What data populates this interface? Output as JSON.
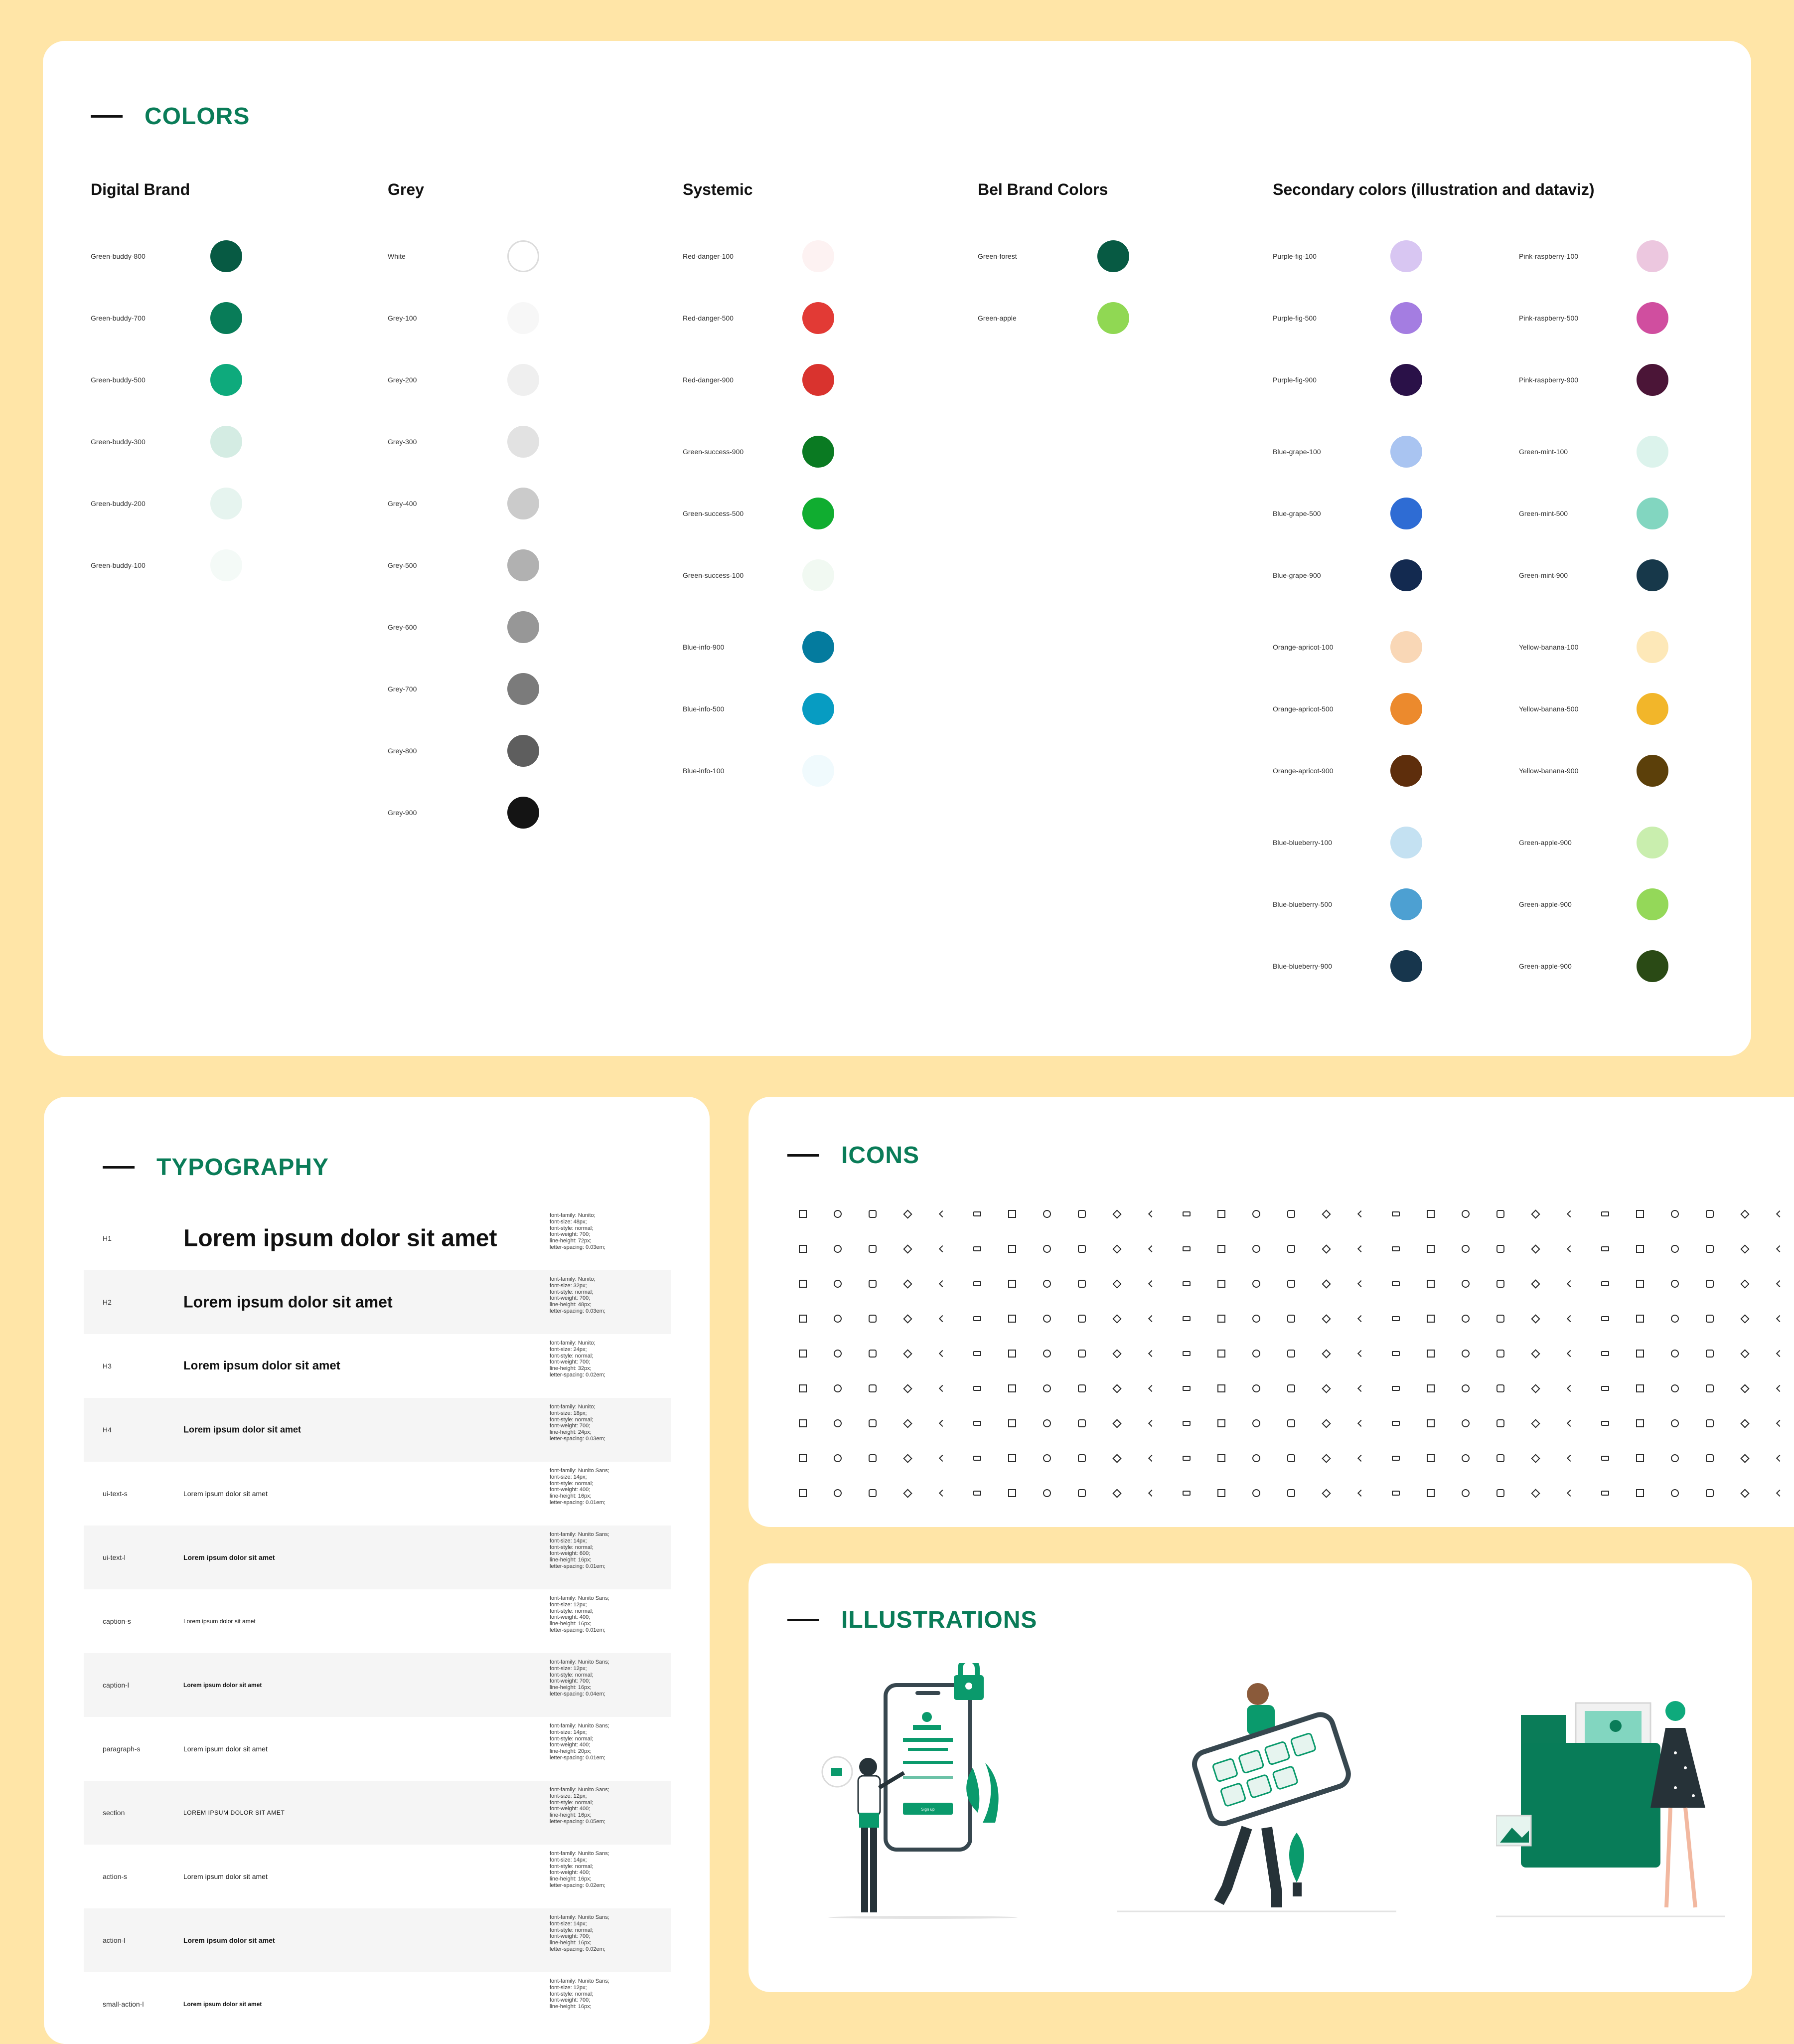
{
  "colors": {
    "title": "COLORS",
    "groups": [
      {
        "title": "Digital Brand",
        "swatches": [
          {
            "label": "Green-buddy-800",
            "color": "#075a43"
          },
          {
            "label": "Green-buddy-700",
            "color": "#087c58"
          },
          {
            "label": "Green-buddy-500",
            "color": "#0eaa7c"
          },
          {
            "label": "Green-buddy-300",
            "color": "#d4ece3"
          },
          {
            "label": "Green-buddy-200",
            "color": "#e6f4ef"
          },
          {
            "label": "Green-buddy-100",
            "color": "#f4faf7"
          }
        ]
      },
      {
        "title": "Grey",
        "swatches": [
          {
            "label": "White",
            "color": "#ffffff"
          },
          {
            "label": "Grey-100",
            "color": "#f7f7f7"
          },
          {
            "label": "Grey-200",
            "color": "#efefef"
          },
          {
            "label": "Grey-300",
            "color": "#e2e2e2"
          },
          {
            "label": "Grey-400",
            "color": "#cbcbcb"
          },
          {
            "label": "Grey-500",
            "color": "#b1b1b1"
          },
          {
            "label": "Grey-600",
            "color": "#979797"
          },
          {
            "label": "Grey-700",
            "color": "#7b7b7b"
          },
          {
            "label": "Grey-800",
            "color": "#5e5e5e"
          },
          {
            "label": "Grey-900",
            "color": "#141414"
          }
        ]
      },
      {
        "title": "Systemic",
        "swatches": [
          {
            "label": "Red-danger-100",
            "color": "#fdf2f2"
          },
          {
            "label": "Red-danger-500",
            "color": "#e23a35"
          },
          {
            "label": "Red-danger-900",
            "color": "#d9332e"
          },
          {
            "label": "Green-success-900",
            "color": "#0a7a22"
          },
          {
            "label": "Green-success-500",
            "color": "#10ad30"
          },
          {
            "label": "Green-success-100",
            "color": "#f1f9f2"
          },
          {
            "label": "Blue-info-900",
            "color": "#047b9e"
          },
          {
            "label": "Blue-info-500",
            "color": "#079cc2"
          },
          {
            "label": "Blue-info-100",
            "color": "#f0fafd"
          }
        ]
      },
      {
        "title": "Bel Brand Colors",
        "swatches": [
          {
            "label": "Green-forest",
            "color": "#075a43"
          },
          {
            "label": "Green-apple",
            "color": "#90d853"
          }
        ]
      },
      {
        "title": "Secondary colors (illustration and dataviz)",
        "left": [
          {
            "label": "Purple-fig-100",
            "color": "#d8c6f2"
          },
          {
            "label": "Purple-fig-500",
            "color": "#a47de1"
          },
          {
            "label": "Purple-fig-900",
            "color": "#2a1148"
          },
          {
            "label": "Blue-grape-100",
            "color": "#a9c4f1"
          },
          {
            "label": "Blue-grape-500",
            "color": "#2e6cd4"
          },
          {
            "label": "Blue-grape-900",
            "color": "#132a50"
          },
          {
            "label": "Orange-apricot-100",
            "color": "#f9d7b6"
          },
          {
            "label": "Orange-apricot-500",
            "color": "#ec8a2d"
          },
          {
            "label": "Orange-apricot-900",
            "color": "#5e2e0c"
          },
          {
            "label": "Blue-blueberry-100",
            "color": "#c4e1f2"
          },
          {
            "label": "Blue-blueberry-500",
            "color": "#4da0d2"
          },
          {
            "label": "Blue-blueberry-900",
            "color": "#17364d"
          }
        ],
        "right": [
          {
            "label": "Pink-raspberry-100",
            "color": "#ecc7df"
          },
          {
            "label": "Pink-raspberry-500",
            "color": "#d04e9f"
          },
          {
            "label": "Pink-raspberry-900",
            "color": "#4b1537"
          },
          {
            "label": "Green-mint-100",
            "color": "#dcf3ec"
          },
          {
            "label": "Green-mint-500",
            "color": "#82d6c0"
          },
          {
            "label": "Green-mint-900",
            "color": "#17384a"
          },
          {
            "label": "Yellow-banana-100",
            "color": "#fde8b8"
          },
          {
            "label": "Yellow-banana-500",
            "color": "#f2b62a"
          },
          {
            "label": "Yellow-banana-900",
            "color": "#5c400a"
          },
          {
            "label": "Green-apple-900",
            "color": "#c9eeae"
          },
          {
            "label": "Green-apple-900",
            "color": "#94d859"
          },
          {
            "label": "Green-apple-900",
            "color": "#2a4a15"
          }
        ]
      }
    ]
  },
  "typography": {
    "title": "TYPOGRAPHY",
    "rows": [
      {
        "name": "H1",
        "sample": "Lorem ipsum dolor sit amet",
        "spec": "font-family: Nunito;\nfont-size: 48px;\nfont-style: normal;\nfont-weight: 700;\nline-height: 72px;\nletter-spacing: 0.03em;"
      },
      {
        "name": "H2",
        "sample": "Lorem ipsum dolor sit amet",
        "spec": "font-family: Nunito;\nfont-size: 32px;\nfont-style: normal;\nfont-weight: 700;\nline-height: 48px;\nletter-spacing: 0.03em;"
      },
      {
        "name": "H3",
        "sample": "Lorem ipsum dolor sit amet",
        "spec": "font-family: Nunito;\nfont-size: 24px;\nfont-style: normal;\nfont-weight: 700;\nline-height: 32px;\nletter-spacing: 0.02em;"
      },
      {
        "name": "H4",
        "sample": "Lorem ipsum dolor sit amet",
        "spec": "font-family: Nunito;\nfont-size: 18px;\nfont-style: normal;\nfont-weight: 700;\nline-height: 24px;\nletter-spacing: 0.03em;"
      },
      {
        "name": "ui-text-s",
        "sample": "Lorem ipsum dolor sit amet",
        "spec": "font-family: Nunito Sans;\nfont-size: 14px;\nfont-style: normal;\nfont-weight: 400;\nline-height: 16px;\nletter-spacing: 0.01em;"
      },
      {
        "name": "ui-text-l",
        "sample": "Lorem ipsum dolor sit amet",
        "spec": "font-family: Nunito Sans;\nfont-size: 14px;\nfont-style: normal;\nfont-weight: 600;\nline-height: 16px;\nletter-spacing: 0.01em;"
      },
      {
        "name": "caption-s",
        "sample": "Lorem ipsum dolor sit amet",
        "spec": "font-family: Nunito Sans;\nfont-size: 12px;\nfont-style: normal;\nfont-weight: 400;\nline-height: 16px;\nletter-spacing: 0.01em;"
      },
      {
        "name": "caption-l",
        "sample": "Lorem ipsum dolor sit amet",
        "spec": "font-family: Nunito Sans;\nfont-size: 12px;\nfont-style: normal;\nfont-weight: 700;\nline-height: 16px;\nletter-spacing: 0.04em;"
      },
      {
        "name": "paragraph-s",
        "sample": "Lorem ipsum dolor sit amet",
        "spec": "font-family: Nunito Sans;\nfont-size: 14px;\nfont-style: normal;\nfont-weight: 400;\nline-height: 20px;\nletter-spacing: 0.01em;"
      },
      {
        "name": "section",
        "sample": "LOREM IPSUM DOLOR SIT AMET",
        "spec": "font-family: Nunito Sans;\nfont-size: 12px;\nfont-style: normal;\nfont-weight: 400;\nline-height: 16px;\nletter-spacing: 0.05em;"
      },
      {
        "name": "action-s",
        "sample": "Lorem ipsum dolor sit amet",
        "spec": "font-family: Nunito Sans;\nfont-size: 14px;\nfont-style: normal;\nfont-weight: 400;\nline-height: 16px;\nletter-spacing: 0.02em;"
      },
      {
        "name": "action-l",
        "sample": "Lorem ipsum dolor sit amet",
        "spec": "font-family: Nunito Sans;\nfont-size: 14px;\nfont-style: normal;\nfont-weight: 700;\nline-height: 16px;\nletter-spacing: 0.02em;"
      },
      {
        "name": "small-action-l",
        "sample": "Lorem ipsum dolor sit amet",
        "spec": "font-family: Nunito Sans;\nfont-size: 12px;\nfont-style: normal;\nfont-weight: 700;\nline-height: 16px;"
      }
    ]
  },
  "icons": {
    "title": "ICONS",
    "rows": 9,
    "per_row": 29
  },
  "illustrations": {
    "title": "ILLUSTRATIONS",
    "button_label": "Sign up"
  },
  "theme": {
    "accent": "#0a7c58",
    "background": "#ffe5a7",
    "card": "#ffffff"
  }
}
